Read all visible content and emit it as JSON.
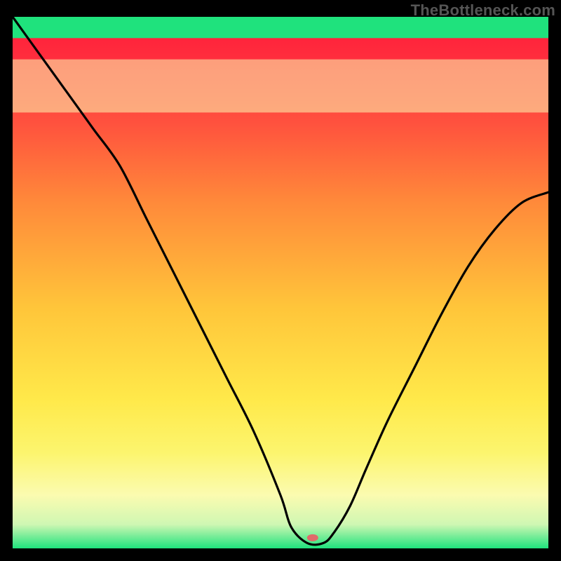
{
  "watermark": "TheBottleneck.com",
  "chart_data": {
    "type": "line",
    "title": "",
    "xlabel": "",
    "ylabel": "",
    "xlim": [
      0,
      100
    ],
    "ylim": [
      0,
      100
    ],
    "grid": false,
    "legend": false,
    "background_gradient": {
      "stops": [
        {
          "offset": 0.0,
          "color": "#ff1a3b"
        },
        {
          "offset": 0.15,
          "color": "#ff3f3f"
        },
        {
          "offset": 0.35,
          "color": "#ff8a3a"
        },
        {
          "offset": 0.55,
          "color": "#ffc63a"
        },
        {
          "offset": 0.72,
          "color": "#ffe94a"
        },
        {
          "offset": 0.82,
          "color": "#fcf56e"
        },
        {
          "offset": 0.9,
          "color": "#fbfbb0"
        },
        {
          "offset": 0.955,
          "color": "#cff7b3"
        },
        {
          "offset": 1.0,
          "color": "#1fe27d"
        }
      ]
    },
    "background_cream_band": {
      "y_from": 82,
      "y_to": 92,
      "color": "#fbfbb0"
    },
    "background_green_band": {
      "y_from": 96,
      "y_to": 100,
      "color": "#1fe27d"
    },
    "marker": {
      "x": 56,
      "y": 98,
      "color": "#e06a6a",
      "rx": 8,
      "ry": 5
    },
    "series": [
      {
        "name": "curve",
        "x": [
          0,
          5,
          10,
          15,
          20,
          25,
          30,
          35,
          40,
          45,
          50,
          52,
          55,
          58,
          60,
          63,
          66,
          70,
          75,
          80,
          85,
          90,
          95,
          100
        ],
        "values": [
          100,
          93,
          86,
          79,
          72,
          62,
          52,
          42,
          32,
          22,
          10,
          4,
          1,
          1,
          3,
          8,
          15,
          24,
          34,
          44,
          53,
          60,
          65,
          67
        ]
      }
    ]
  }
}
